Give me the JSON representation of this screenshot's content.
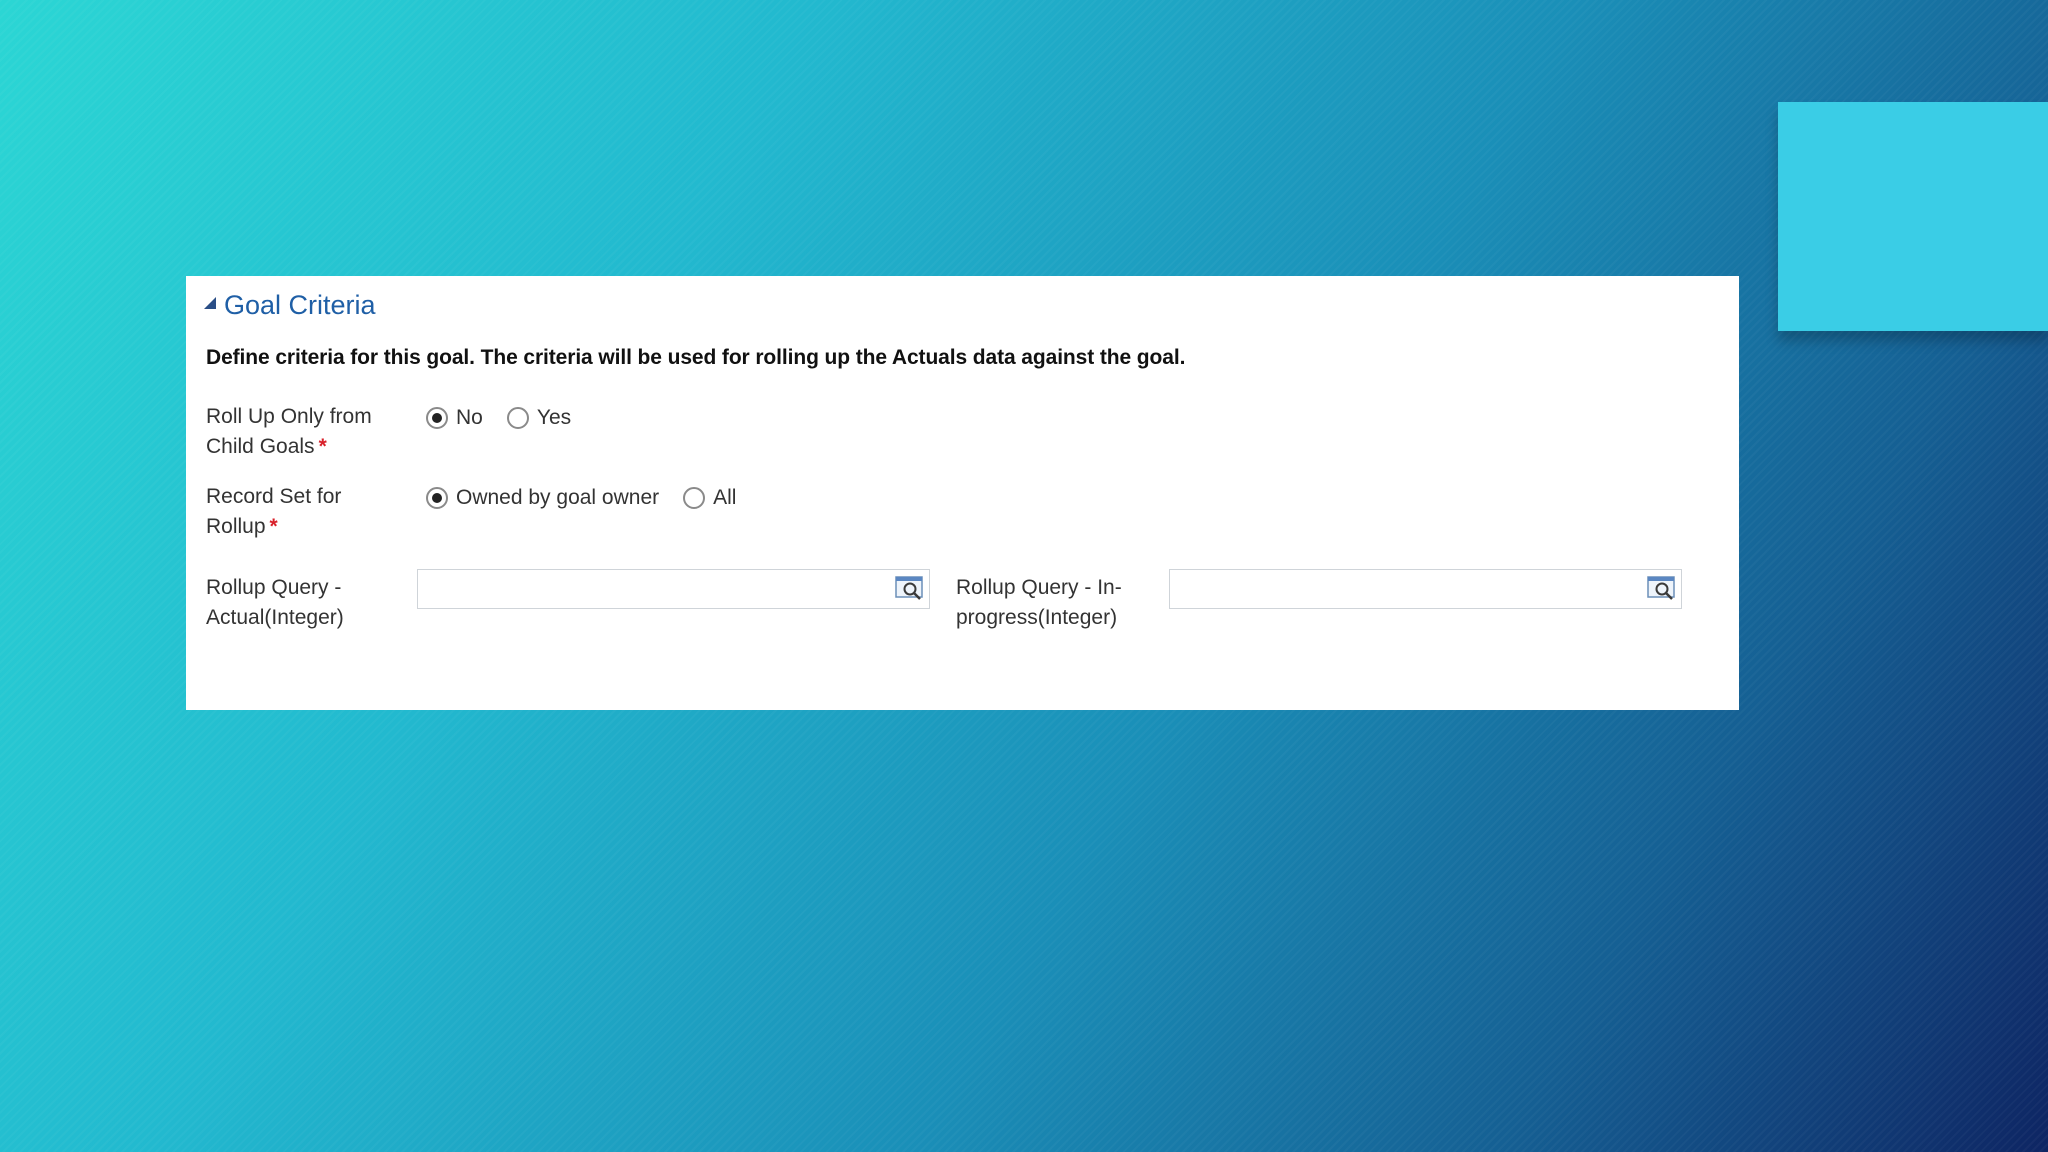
{
  "section": {
    "title": "Goal Criteria",
    "description": "Define criteria for this goal. The criteria will be used for rolling up the Actuals data against the goal."
  },
  "fields": {
    "rollup_child": {
      "label": "Roll Up Only from\nChild Goals",
      "required_mark": "*",
      "options": [
        {
          "label": "No",
          "checked": true
        },
        {
          "label": "Yes",
          "checked": false
        }
      ]
    },
    "record_set": {
      "label": "Record Set for\nRollup",
      "required_mark": "*",
      "options": [
        {
          "label": "Owned by goal owner",
          "checked": true
        },
        {
          "label": "All",
          "checked": false
        }
      ]
    },
    "query_actual": {
      "label": "Rollup Query -\nActual(Integer)",
      "value": ""
    },
    "query_inprogress": {
      "label": "Rollup Query - In-\nprogress(Integer)",
      "value": ""
    }
  },
  "icons": {
    "collapse": "collapse-triangle-icon",
    "lookup": "lookup-search-icon"
  },
  "colors": {
    "title": "#1f5fa6",
    "required": "#d8202a",
    "accent_block": "#3acde6"
  }
}
